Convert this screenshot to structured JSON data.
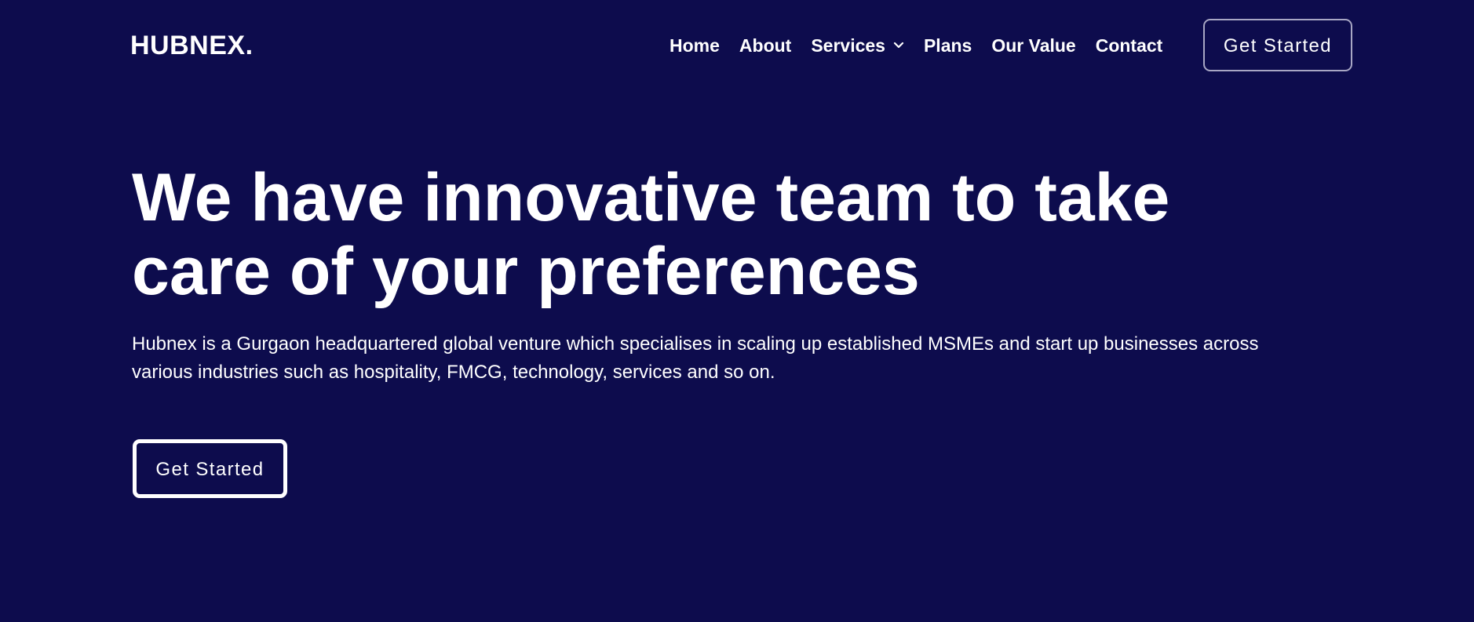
{
  "header": {
    "logo_text": "HUBNEX.",
    "nav": {
      "items": [
        {
          "label": "Home"
        },
        {
          "label": "About"
        },
        {
          "label": "Services",
          "has_dropdown": true
        },
        {
          "label": "Plans"
        },
        {
          "label": "Our Value"
        },
        {
          "label": "Contact"
        }
      ]
    },
    "cta_label": "Get Started"
  },
  "hero": {
    "title": "We have innovative team to take care of your preferences",
    "description": "Hubnex is a Gurgaon headquartered global venture which specialises in scaling up established MSMEs and start up businesses across various industries such as hospitality, FMCG, technology, services and so on.",
    "cta_label": "Get Started"
  },
  "theme": {
    "background": "#0d0c4d",
    "text": "#ffffff",
    "header_button_border": "#a8a7c4"
  },
  "icons": {
    "services_dropdown": "chevron-down-icon"
  }
}
